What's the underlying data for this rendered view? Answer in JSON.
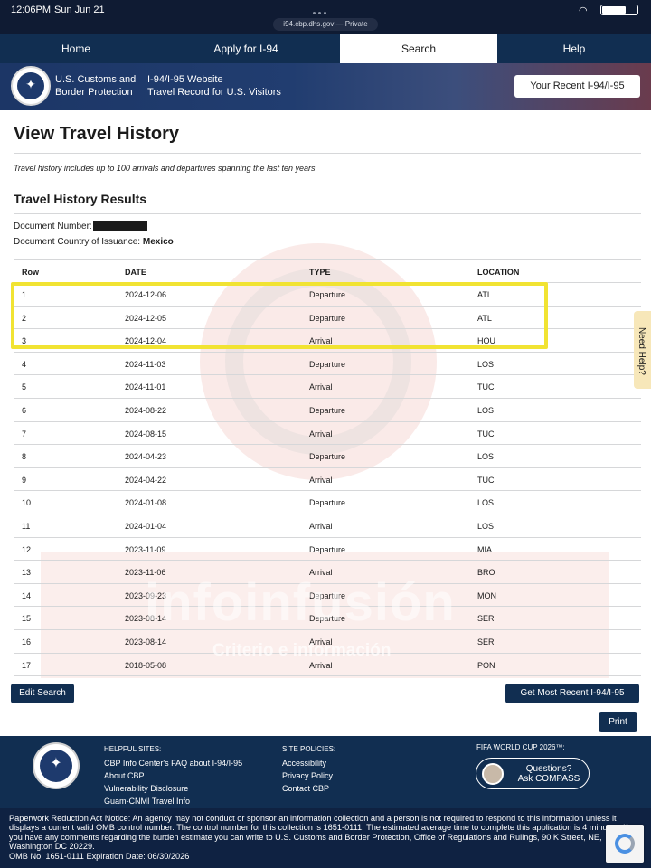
{
  "status_bar": {
    "time": "12:06PM",
    "date": "Sun Jun 21",
    "url": "i94.cbp.dhs.gov — Private"
  },
  "nav": {
    "home": "Home",
    "apply": "Apply for I-94",
    "search": "Search",
    "help": "Help"
  },
  "banner": {
    "agency_line1": "U.S. Customs and",
    "agency_line2": "Border Protection",
    "site_line1": "I-94/I-95 Website",
    "site_line2": "Travel Record for U.S. Visitors",
    "recent_button": "Your Recent I-94/I-95"
  },
  "page": {
    "title": "View Travel History",
    "intro": "Travel history includes up to 100 arrivals and departures spanning the last ten years",
    "results_title": "Travel History Results",
    "document_number_label": "Document Number:",
    "document_country_label": "Document Country of Issuance:",
    "document_country_value": "Mexico"
  },
  "table": {
    "headers": [
      "Row",
      "DATE",
      "TYPE",
      "LOCATION"
    ],
    "rows": [
      [
        "1",
        "2024-12-06",
        "Departure",
        "ATL"
      ],
      [
        "2",
        "2024-12-05",
        "Departure",
        "ATL"
      ],
      [
        "3",
        "2024-12-04",
        "Arrival",
        "HOU"
      ],
      [
        "4",
        "2024-11-03",
        "Departure",
        "LOS"
      ],
      [
        "5",
        "2024-11-01",
        "Arrival",
        "TUC"
      ],
      [
        "6",
        "2024-08-22",
        "Departure",
        "LOS"
      ],
      [
        "7",
        "2024-08-15",
        "Arrival",
        "TUC"
      ],
      [
        "8",
        "2024-04-23",
        "Departure",
        "LOS"
      ],
      [
        "9",
        "2024-04-22",
        "Arrival",
        "TUC"
      ],
      [
        "10",
        "2024-01-08",
        "Departure",
        "LOS"
      ],
      [
        "11",
        "2024-01-04",
        "Arrival",
        "LOS"
      ],
      [
        "12",
        "2023-11-09",
        "Departure",
        "MIA"
      ],
      [
        "13",
        "2023-11-06",
        "Arrival",
        "BRO"
      ],
      [
        "14",
        "2023-09-23",
        "Departure",
        "MON"
      ],
      [
        "15",
        "2023-08-14",
        "Departure",
        "SER"
      ],
      [
        "16",
        "2023-08-14",
        "Arrival",
        "SER"
      ],
      [
        "17",
        "2018-05-08",
        "Arrival",
        "PON"
      ]
    ]
  },
  "watermark": {
    "brand": "infoinfusión",
    "tagline": "Criterio e información"
  },
  "side_tab": "Need Help?",
  "buttons": {
    "edit_search": "Edit Search",
    "get_recent": "Get Most Recent I-94/I-95",
    "print": "Print"
  },
  "footer": {
    "helpful_heading": "HELPFUL SITES:",
    "helpful_links": [
      "CBP Info Center's FAQ about I-94/I-95",
      "About CBP",
      "Vulnerability Disclosure",
      "Guam-CNMI Travel Info"
    ],
    "policy_heading": "SITE POLICIES:",
    "policy_links": [
      "Accessibility",
      "Privacy Policy",
      "Contact CBP"
    ],
    "fifa_heading": "FIFA WORLD CUP 2026™:",
    "compass_line1": "Questions?",
    "compass_line2": "Ask COMPASS"
  },
  "notice": {
    "text": "Paperwork Reduction Act Notice: An agency may not conduct or sponsor an information collection and a person is not required to respond to this information unless it displays a current valid OMB control number. The control number for this collection is 1651-0111. The estimated average time to complete this application is 4 minutes. If you have any comments regarding the burden estimate you can write to U.S. Customs and Border Protection, Office of Regulations and Rulings, 90 K Street, NE, Washington DC 20229.",
    "omb": "OMB No. 1651-0111 Expiration Date: 06/30/2026"
  }
}
